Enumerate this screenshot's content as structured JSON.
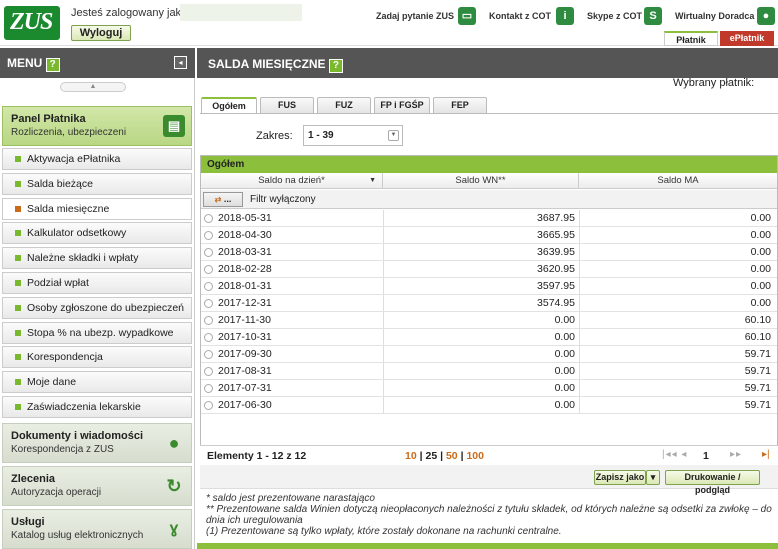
{
  "header": {
    "logo": "ZUS",
    "logged_as": "Jesteś zalogowany jako:",
    "logout_label": "Wyloguj",
    "links": [
      {
        "label": "Zadaj pytanie ZUS",
        "icon": "chat-icon"
      },
      {
        "label": "Kontakt z COT",
        "icon": "info-icon"
      },
      {
        "label": "Skype z COT",
        "icon": "skype-icon"
      },
      {
        "label": "Wirtualny Doradca",
        "icon": "person-icon"
      }
    ],
    "role_tabs": [
      "Płatnik",
      "ePłatnik"
    ]
  },
  "menu": {
    "title": "MENU",
    "help": "?",
    "panels": [
      {
        "title": "Panel Płatnika",
        "subtitle": "Rozliczenia, ubezpieczeni"
      },
      {
        "title": "Dokumenty i wiadomości",
        "subtitle": "Korespondencja z ZUS"
      },
      {
        "title": "Zlecenia",
        "subtitle": "Autoryzacja operacji"
      },
      {
        "title": "Usługi",
        "subtitle": "Katalog usług elektronicznych"
      }
    ],
    "items": [
      "Aktywacja ePłatnika",
      "Salda bieżące",
      "Salda miesięczne",
      "Kalkulator odsetkowy",
      "Należne składki i wpłaty",
      "Podział wpłat",
      "Osoby zgłoszone do ubezpieczeń",
      "Stopa % na ubezp. wypadkowe",
      "Korespondencja",
      "Moje dane",
      "Zaświadczenia lekarskie"
    ]
  },
  "main": {
    "title": "SALDA MIESIĘCZNE",
    "help": "?",
    "payer_label": "Wybrany płatnik:",
    "tabs": [
      "Ogółem",
      "FUS",
      "FUZ",
      "FP i FGŚP",
      "FEP"
    ],
    "range_label": "Zakres:",
    "range_value": "1 - 39",
    "grid": {
      "group_title": "Ogółem",
      "columns": [
        "Saldo na dzień*",
        "Saldo WN**",
        "Saldo MA"
      ],
      "filter_button": "...",
      "filter_text": "Filtr wyłączony",
      "rows": [
        {
          "date": "2018-05-31",
          "wn": "3687.95",
          "ma": "0.00"
        },
        {
          "date": "2018-04-30",
          "wn": "3665.95",
          "ma": "0.00"
        },
        {
          "date": "2018-03-31",
          "wn": "3639.95",
          "ma": "0.00"
        },
        {
          "date": "2018-02-28",
          "wn": "3620.95",
          "ma": "0.00"
        },
        {
          "date": "2018-01-31",
          "wn": "3597.95",
          "ma": "0.00"
        },
        {
          "date": "2017-12-31",
          "wn": "3574.95",
          "ma": "0.00"
        },
        {
          "date": "2017-11-30",
          "wn": "0.00",
          "ma": "60.10"
        },
        {
          "date": "2017-10-31",
          "wn": "0.00",
          "ma": "60.10"
        },
        {
          "date": "2017-09-30",
          "wn": "0.00",
          "ma": "59.71"
        },
        {
          "date": "2017-08-31",
          "wn": "0.00",
          "ma": "59.71"
        },
        {
          "date": "2017-07-31",
          "wn": "0.00",
          "ma": "59.71"
        },
        {
          "date": "2017-06-30",
          "wn": "0.00",
          "ma": "59.71"
        }
      ]
    },
    "pager": {
      "elements": "Elementy 1 - 12 z 12",
      "sizes": [
        "10",
        "25",
        "50",
        "100"
      ],
      "page": "1"
    },
    "actions": {
      "save_as": "Zapisz jako",
      "print": "Drukowanie / podgląd"
    },
    "notes": [
      "* saldo jest prezentowane narastająco",
      "** Prezentowane salda Winien dotyczą nieopłaconych należności z tytułu składek, od których należne są odsetki za zwłokę – do dnia ich uregulowania",
      "(1) Prezentowane są tylko wpłaty, które zostały dokonane na rachunki centralne."
    ]
  },
  "colors": {
    "accent": "#8bbf3c",
    "brand": "#1b8a2e",
    "header": "#555555",
    "highlight": "#c96b1a"
  }
}
